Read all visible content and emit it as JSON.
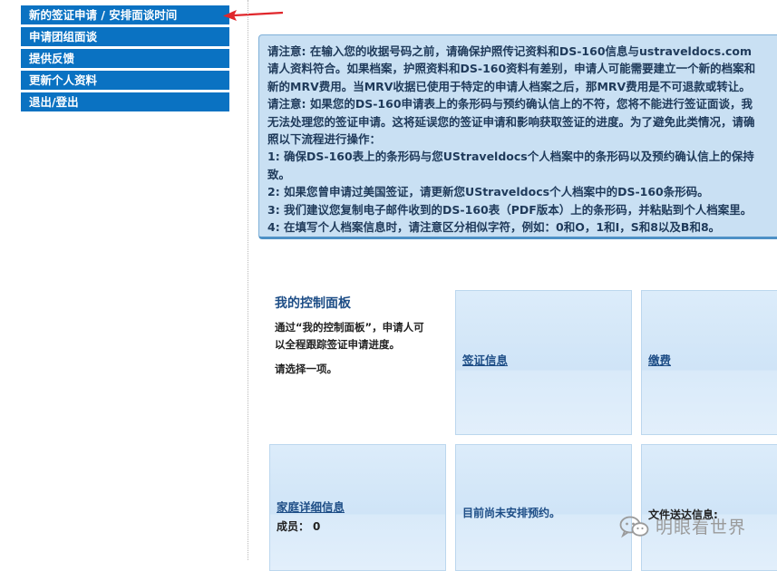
{
  "sidebar": {
    "items": [
      {
        "label": "新的签证申请 / 安排面谈时间"
      },
      {
        "label": "申请团组面谈"
      },
      {
        "label": "提供反馈"
      },
      {
        "label": "更新个人资料"
      },
      {
        "label": "退出/登出"
      }
    ]
  },
  "notice": {
    "lines": [
      "请注意: 在输入您的收据号码之前，请确保护照传记资料和DS-160信息与ustraveldocs.com",
      "请人资料符合。如果档案，护照资料和DS-160资料有差别，申请人可能需要建立一个新的档案和",
      "新的MRV费用。当MRV收据已使用于特定的申请人档案之后，那MRV费用是不可退款或转让。",
      "请注意: 如果您的DS-160申请表上的条形码与预约确认信上的不符，您将不能进行签证面谈，我",
      "无法处理您的签证申请。这将延误您的签证申请和影响获取签证的进度。为了避免此类情况，请确",
      "照以下流程进行操作：",
      "1: 确保DS-160表上的条形码与您UStraveldocs个人档案中的条形码以及预约确认信上的保持",
      "致。",
      "2: 如果您曾申请过美国签证，请更新您UStraveldocs个人档案中的DS-160条形码。",
      "3: 我们建议您复制电子邮件收到的DS-160表（PDF版本）上的条形码，并粘贴到个人档案里。",
      "4: 在填写个人档案信息时，请注意区分相似字符，例如：0和O，1和I，S和8以及B和8。"
    ]
  },
  "dashboard": {
    "title": "我的控制面板",
    "desc_line1": "通过“我的控制面板”，申请人可",
    "desc_line2": "以全程跟踪签证申请进度。",
    "select_prompt": "请选择一项。"
  },
  "tiles": {
    "visa_info": "签证信息",
    "payment": "缴费",
    "family_details": "家庭详细信息",
    "members_label": "成员：",
    "members_count": "0",
    "no_appointment": "目前尚未安排预约。",
    "doc_delivery": "文件送达信息:"
  },
  "watermark": {
    "text": "明眼看世界"
  },
  "colors": {
    "nav_bg": "#0a72c2",
    "notice_bg": "#c9e0f3",
    "link": "#1d4d86",
    "arrow": "#e0262b"
  }
}
